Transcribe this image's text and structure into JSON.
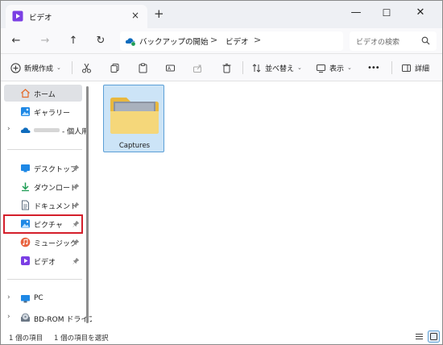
{
  "window": {
    "tab_title": "ビデオ",
    "new_tab": "+",
    "tab_close": "×",
    "minimize": "—",
    "maximize": "☐",
    "close": "✕"
  },
  "nav": {
    "back": "←",
    "forward": "→",
    "up": "↑",
    "refresh": "↻",
    "breadcrumbs": [
      "バックアップの開始",
      "ビデオ"
    ],
    "separator": ">",
    "search_placeholder": "ビデオの検索"
  },
  "toolbar": {
    "new_label": "新規作成",
    "sort_label": "並べ替え",
    "view_label": "表示",
    "more_label": "•••",
    "details_label": "詳細"
  },
  "sidebar": {
    "quick": [
      {
        "label": "ホーム",
        "icon": "home-icon",
        "selected": true
      },
      {
        "label": "ギャラリー",
        "icon": "gallery-icon"
      },
      {
        "label": "- 個人用",
        "icon": "onedrive-cloud-icon",
        "expandable": true
      }
    ],
    "pinned": [
      {
        "label": "デスクトップ",
        "icon": "desktop-icon"
      },
      {
        "label": "ダウンロード",
        "icon": "download-icon"
      },
      {
        "label": "ドキュメント",
        "icon": "document-icon"
      },
      {
        "label": "ピクチャ",
        "icon": "pictures-icon",
        "highlighted": true
      },
      {
        "label": "ミュージック",
        "icon": "music-icon"
      },
      {
        "label": "ビデオ",
        "icon": "video-icon"
      }
    ],
    "devices": [
      {
        "label": "PC",
        "icon": "pc-icon"
      },
      {
        "label": "BD-ROM ドライブ",
        "icon": "disc-drive-icon"
      }
    ]
  },
  "content": {
    "items": [
      {
        "name": "Captures",
        "icon": "folder-icon"
      }
    ]
  },
  "status": {
    "count": "1 個の項目",
    "selected": "1 個の項目を選択"
  },
  "colors": {
    "accent_blue": "#0067c0",
    "folder_yellow": "#f3cf6a",
    "video_purple": "#7b3fe4",
    "highlight_red": "#d41f2b",
    "selection_bg": "#cce4f7"
  }
}
